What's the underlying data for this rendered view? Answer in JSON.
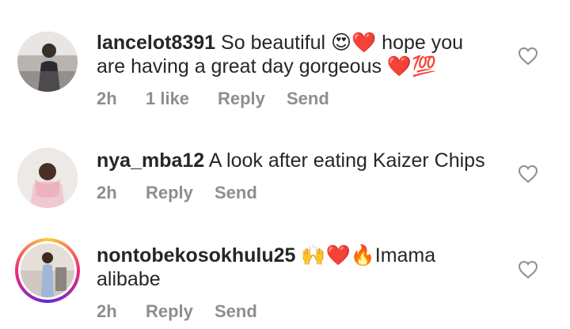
{
  "comments": [
    {
      "username": "lancelot8391",
      "text": "So beautiful 😍❤️ hope you are having a great day gorgeous ❤️💯",
      "time": "2h",
      "likes": "1 like",
      "reply_label": "Reply",
      "send_label": "Send"
    },
    {
      "username": "nya_mba12",
      "text": "A look after eating Kaizer Chips",
      "time": "2h",
      "reply_label": "Reply",
      "send_label": "Send"
    },
    {
      "username": "nontobekosokhulu25",
      "text": "🙌❤️🔥Imama alibabe",
      "time": "2h",
      "reply_label": "Reply",
      "send_label": "Send",
      "has_story_ring": true
    }
  ],
  "colors": {
    "text": "#262626",
    "meta": "#8e8e8e",
    "heart_outline": "#8e8e8e"
  },
  "icons": {
    "like": "heart-outline-icon"
  }
}
